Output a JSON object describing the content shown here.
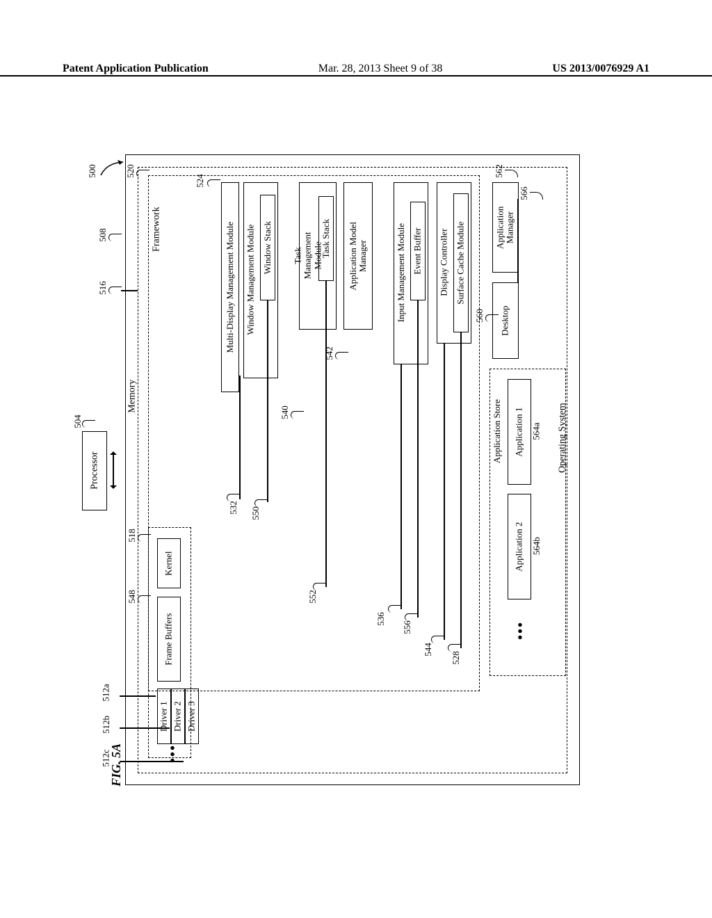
{
  "header": {
    "left": "Patent Application Publication",
    "center": "Mar. 28, 2013  Sheet 9 of 38",
    "right": "US 2013/0076929 A1"
  },
  "figure_label": "FIG. 5A",
  "refs": {
    "r500": "500",
    "r504": "504",
    "r508": "508",
    "r512a": "512a",
    "r512b": "512b",
    "r512c": "512c",
    "r516": "516",
    "r518": "518",
    "r520": "520",
    "r524": "524",
    "r528": "528",
    "r532": "532",
    "r536": "536",
    "r540": "540",
    "r542": "542",
    "r544": "544",
    "r548": "548",
    "r550": "550",
    "r552": "552",
    "r556": "556",
    "r560": "560",
    "r562": "562",
    "r564a": "564a",
    "r564b": "564b",
    "r566": "566"
  },
  "labels": {
    "processor": "Processor",
    "memory": "Memory",
    "framework": "Framework",
    "operating_system": "Operating System",
    "kernel": "Kernel",
    "frame_buffers": "Frame Buffers",
    "driver1": "Driver 1",
    "driver2": "Driver 2",
    "driver3": "Driver 3",
    "mdmm": "Multi-Display Management Module",
    "wmm": "Window Management Module",
    "window_stack": "Window Stack",
    "tmm": "Task\nManagement\nModule",
    "task_stack": "Task Stack",
    "amm": "Application Model\nManager",
    "imm": "Input Management Module",
    "event_buffer": "Event Buffer",
    "dc": "Display Controller",
    "scm": "Surface Cache Module",
    "app_manager": "Application\nManager",
    "desktop": "Desktop",
    "app_store": "Application Store",
    "app1": "Application 1",
    "app2": "Application 2"
  },
  "dots": "•••"
}
